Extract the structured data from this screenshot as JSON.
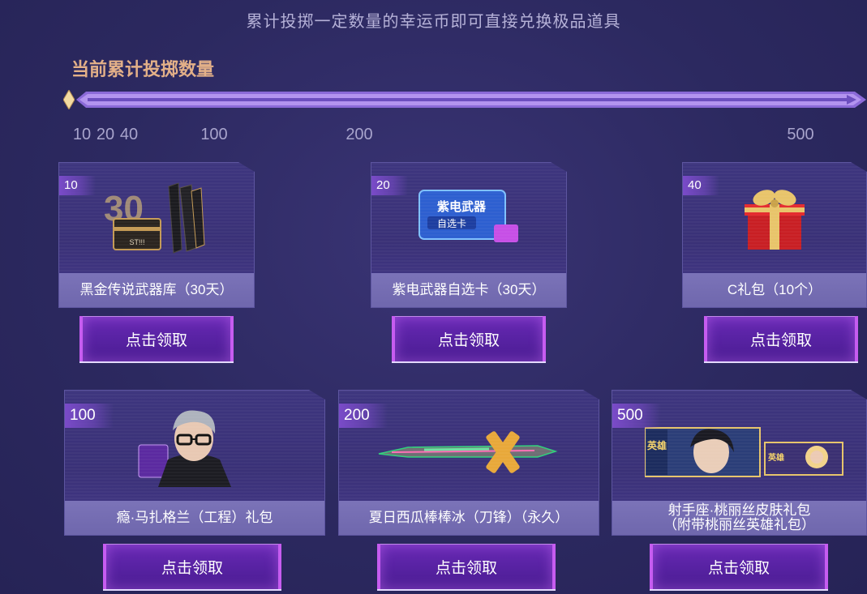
{
  "header": {
    "subtitle": "累计投掷一定数量的幸运币即可直接兑换极品道具",
    "progress_title": "当前累计投掷数量"
  },
  "progress": {
    "current": 0,
    "ticks": [
      "10",
      "20",
      "40",
      "100",
      "200",
      "500"
    ]
  },
  "rewards": [
    {
      "count": "10",
      "name": "黑金传说武器库（30天）",
      "button": "点击领取",
      "icon": "weapon-crate-icon"
    },
    {
      "count": "20",
      "name": "紫电武器自选卡（30天）",
      "button": "点击领取",
      "icon": "weapon-select-card-icon",
      "card_text_line1": "紫电武器",
      "card_text_line2": "自选卡"
    },
    {
      "count": "40",
      "name": "C礼包（10个）",
      "button": "点击领取",
      "icon": "gift-box-icon"
    },
    {
      "count": "100",
      "name": "瘾·马扎格兰（工程）礼包",
      "button": "点击领取",
      "icon": "character-portrait-icon"
    },
    {
      "count": "200",
      "name": "夏日西瓜棒棒冰（刀锋）（永久）",
      "button": "点击领取",
      "icon": "blade-weapon-icon"
    },
    {
      "count": "500",
      "name_line1": "射手座·桃丽丝皮肤礼包",
      "name_line2": "（附带桃丽丝英雄礼包）",
      "button": "点击领取",
      "icon": "hero-skin-card-icon",
      "card_text": "英雄",
      "card_text_small": "英雄"
    }
  ],
  "colors": {
    "background": "#2c2960",
    "accent_orange": "#e3b088",
    "button_purple": "#5a23a5",
    "track_purple": "#9d7be0"
  }
}
